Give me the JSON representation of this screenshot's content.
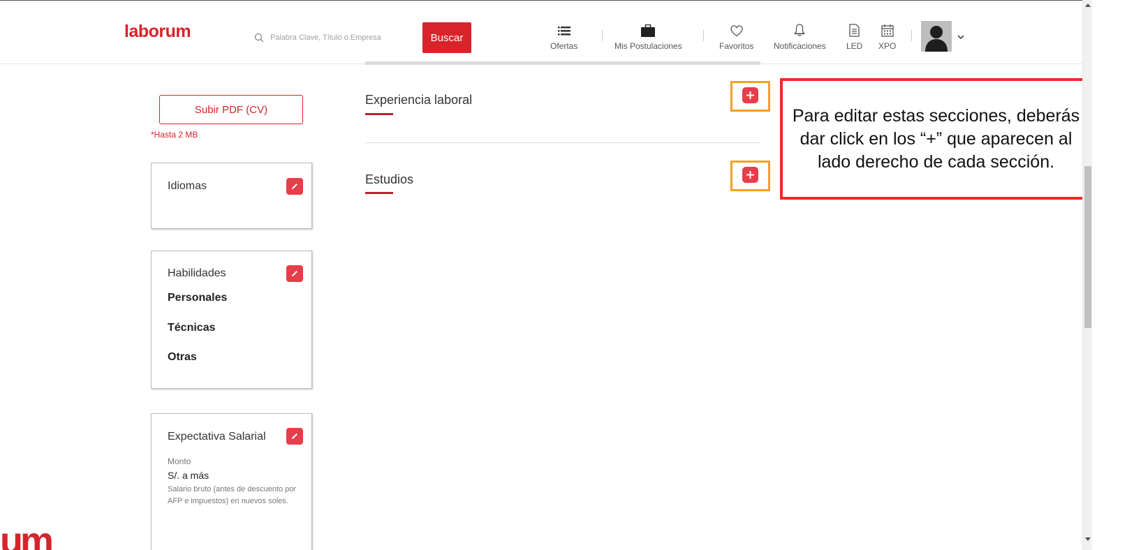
{
  "header": {
    "logo": "laborum",
    "search_placeholder": "Palabra Clave, Título o Empresa",
    "search_button": "Buscar",
    "nav": {
      "ofertas": "Ofertas",
      "postulaciones": "Mis Postulaciones",
      "favoritos": "Favoritos",
      "notificaciones": "Notificaciones",
      "led": "LED",
      "xpo": "XPO"
    }
  },
  "sidebar": {
    "upload_button": "Subir PDF (CV)",
    "upload_note": "*Hasta 2 MB",
    "idiomas": {
      "title": "Idiomas"
    },
    "habilidades": {
      "title": "Habilidades",
      "personales": "Personales",
      "tecnicas": "Técnicas",
      "otras": "Otras"
    },
    "expectativa": {
      "title": "Expectativa Salarial",
      "monto_label": "Monto",
      "monto_value": "S/. a más",
      "description": "Salario bruto (antes de descuento por AFP e impuestos) en nuevos soles."
    }
  },
  "main": {
    "experiencia": "Experiencia laboral",
    "estudios": "Estudios"
  },
  "callout": {
    "text": "Para editar estas secciones, deberás dar click en los “+” que aparecen al lado derecho de cada sección."
  },
  "corner_brand": "um",
  "colors": {
    "brand_red": "#d8232a",
    "edit_red": "#e83d4a",
    "highlight_orange": "#f5a020",
    "callout_border": "#f02a2a"
  }
}
